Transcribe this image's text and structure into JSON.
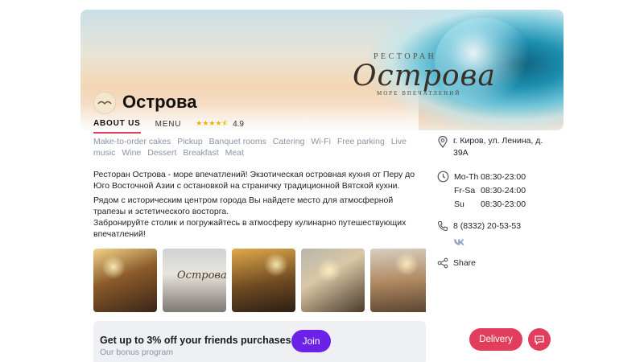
{
  "banner": {
    "logo_top": "РЕСТОРАН",
    "logo_main": "Острова",
    "logo_sub": "МОРЕ ВПЕЧАТЛЕНИЙ"
  },
  "restaurant": {
    "name": "Острова"
  },
  "tabs": [
    {
      "label": "ABOUT US",
      "active": true
    },
    {
      "label": "MENU",
      "active": false
    }
  ],
  "rating": {
    "value": "4.9",
    "stars": 4.5
  },
  "tags": [
    "Make-to-order cakes",
    "Pickup",
    "Banquet rooms",
    "Catering",
    "Wi-Fi",
    "Free parking",
    "Live music",
    "Wine",
    "Dessert",
    "Breakfast",
    "Meat"
  ],
  "description": {
    "p1": "Ресторан Острова - море впечатлений! Экзотическая островная кухня от Перу до Юго Восточной Азии с остановкой на страничку традиционной Вятской кухни.",
    "p2": "Рядом с историческим центром города Вы найдете место для атмосферной трапезы и эстетического восторга.",
    "p3": "Забронируйте столик и погружайтесь в атмосферу кулинарно путешествующих впечатлений!"
  },
  "info": {
    "address": "г. Киров, ул. Ленина, д. 39А",
    "hours": [
      {
        "day": "Mo-Th",
        "time": "08:30-23:00"
      },
      {
        "day": "Fr-Sa",
        "time": "08:30-24:00"
      },
      {
        "day": "Su",
        "time": "08:30-23:00"
      }
    ],
    "phone": "8 (8332) 20-53-53",
    "vk_label": "vk",
    "share_label": "Share"
  },
  "bonus": {
    "title": "Get up to 3% off your friends purchases",
    "subtitle": "Our bonus program",
    "join_label": "Join"
  },
  "floating": {
    "delivery_label": "Delivery"
  },
  "colors": {
    "accent": "#e23d5a",
    "join": "#6b21e8",
    "tag": "#8a94a6",
    "star": "#f0b400"
  },
  "icons": {
    "address": "map-pin-icon",
    "hours": "clock-icon",
    "phone": "phone-icon",
    "social": "vk-icon",
    "share": "share-icon",
    "chat": "chat-icon"
  }
}
